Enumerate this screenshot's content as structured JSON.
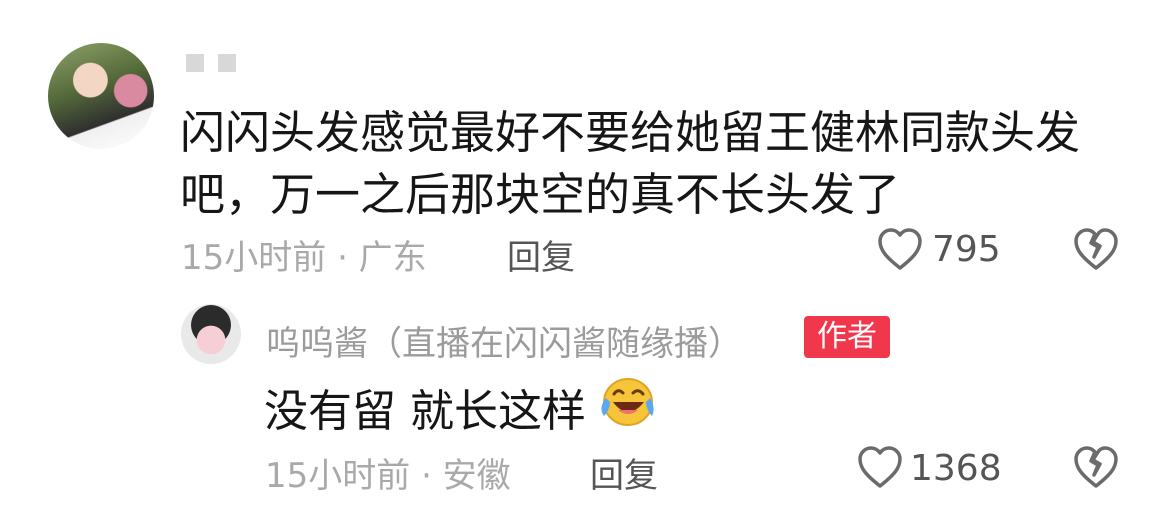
{
  "comment": {
    "text_line1": "闪闪头发感觉最好不要给她留王健林同款头发",
    "text_line2": "吧，万一之后那块空的真不长头发了",
    "meta": "15小时前 · 广东",
    "reply_label": "回复",
    "like_count": "795"
  },
  "reply": {
    "author": "呜呜酱（直播在闪闪酱随缘播）",
    "badge": "作者",
    "text": "没有留 就长这样",
    "meta": "15小时前 · 安徽",
    "reply_label": "回复",
    "like_count": "1368"
  },
  "icons": {
    "like": "heart-outline-icon",
    "dislike": "broken-heart-icon",
    "emoji": "laughing-crying-emoji"
  },
  "colors": {
    "badge": "#f0374c",
    "meta": "#a9a9a9"
  }
}
